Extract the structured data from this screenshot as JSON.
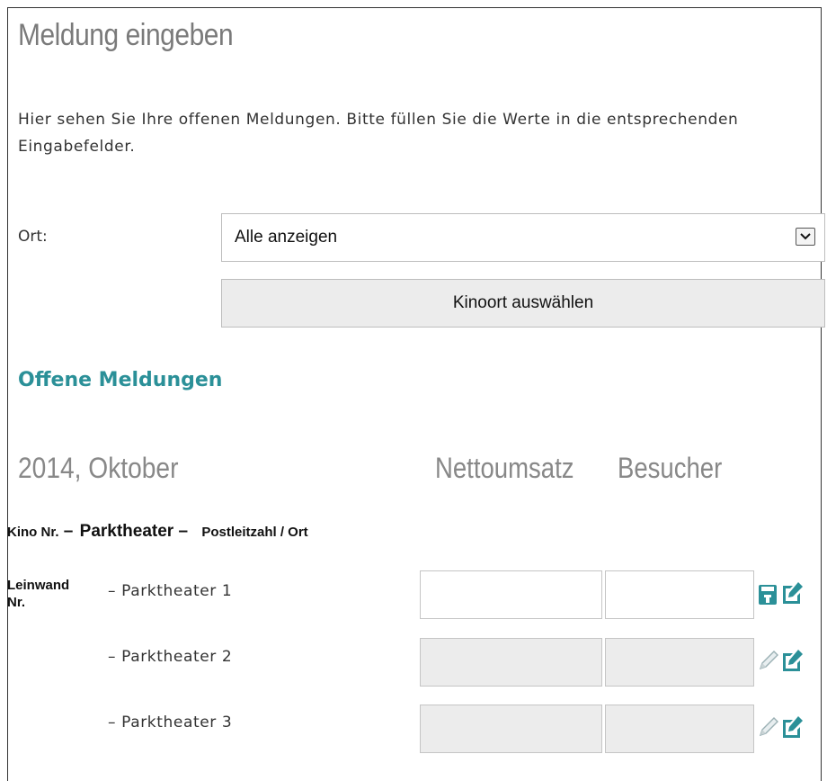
{
  "page": {
    "title": "Meldung eingeben",
    "intro": "Hier sehen Sie Ihre offenen Meldungen. Bitte füllen Sie die Werte in die entsprechenden Eingabefelder."
  },
  "filter": {
    "ort_label": "Ort:",
    "ort_selected": "Alle anzeigen",
    "submit_label": "Kinoort auswählen"
  },
  "section": {
    "title": "Offene Meldungen",
    "month": "2014, Oktober",
    "col_netto": "Nettoumsatz",
    "col_besucher": "Besucher"
  },
  "kino": {
    "nr_label": "Kino Nr.",
    "sep1": " – ",
    "name": "Parktheater",
    "sep2": " – ",
    "plz_label": "Postleitzahl / Ort"
  },
  "leinwand_label_1": "Leinwand",
  "leinwand_label_2": "Nr.",
  "screens": [
    {
      "name": "– Parktheater 1",
      "netto": "",
      "besucher": "",
      "editable": true,
      "icon": "save-icon"
    },
    {
      "name": "– Parktheater 2",
      "netto": "",
      "besucher": "",
      "editable": false,
      "icon": "pencil-icon"
    },
    {
      "name": "– Parktheater 3",
      "netto": "",
      "besucher": "",
      "editable": false,
      "icon": "pencil-icon"
    }
  ],
  "colors": {
    "accent": "#2b9098",
    "heading_gray": "#888888",
    "disabled_field": "#ececec"
  }
}
